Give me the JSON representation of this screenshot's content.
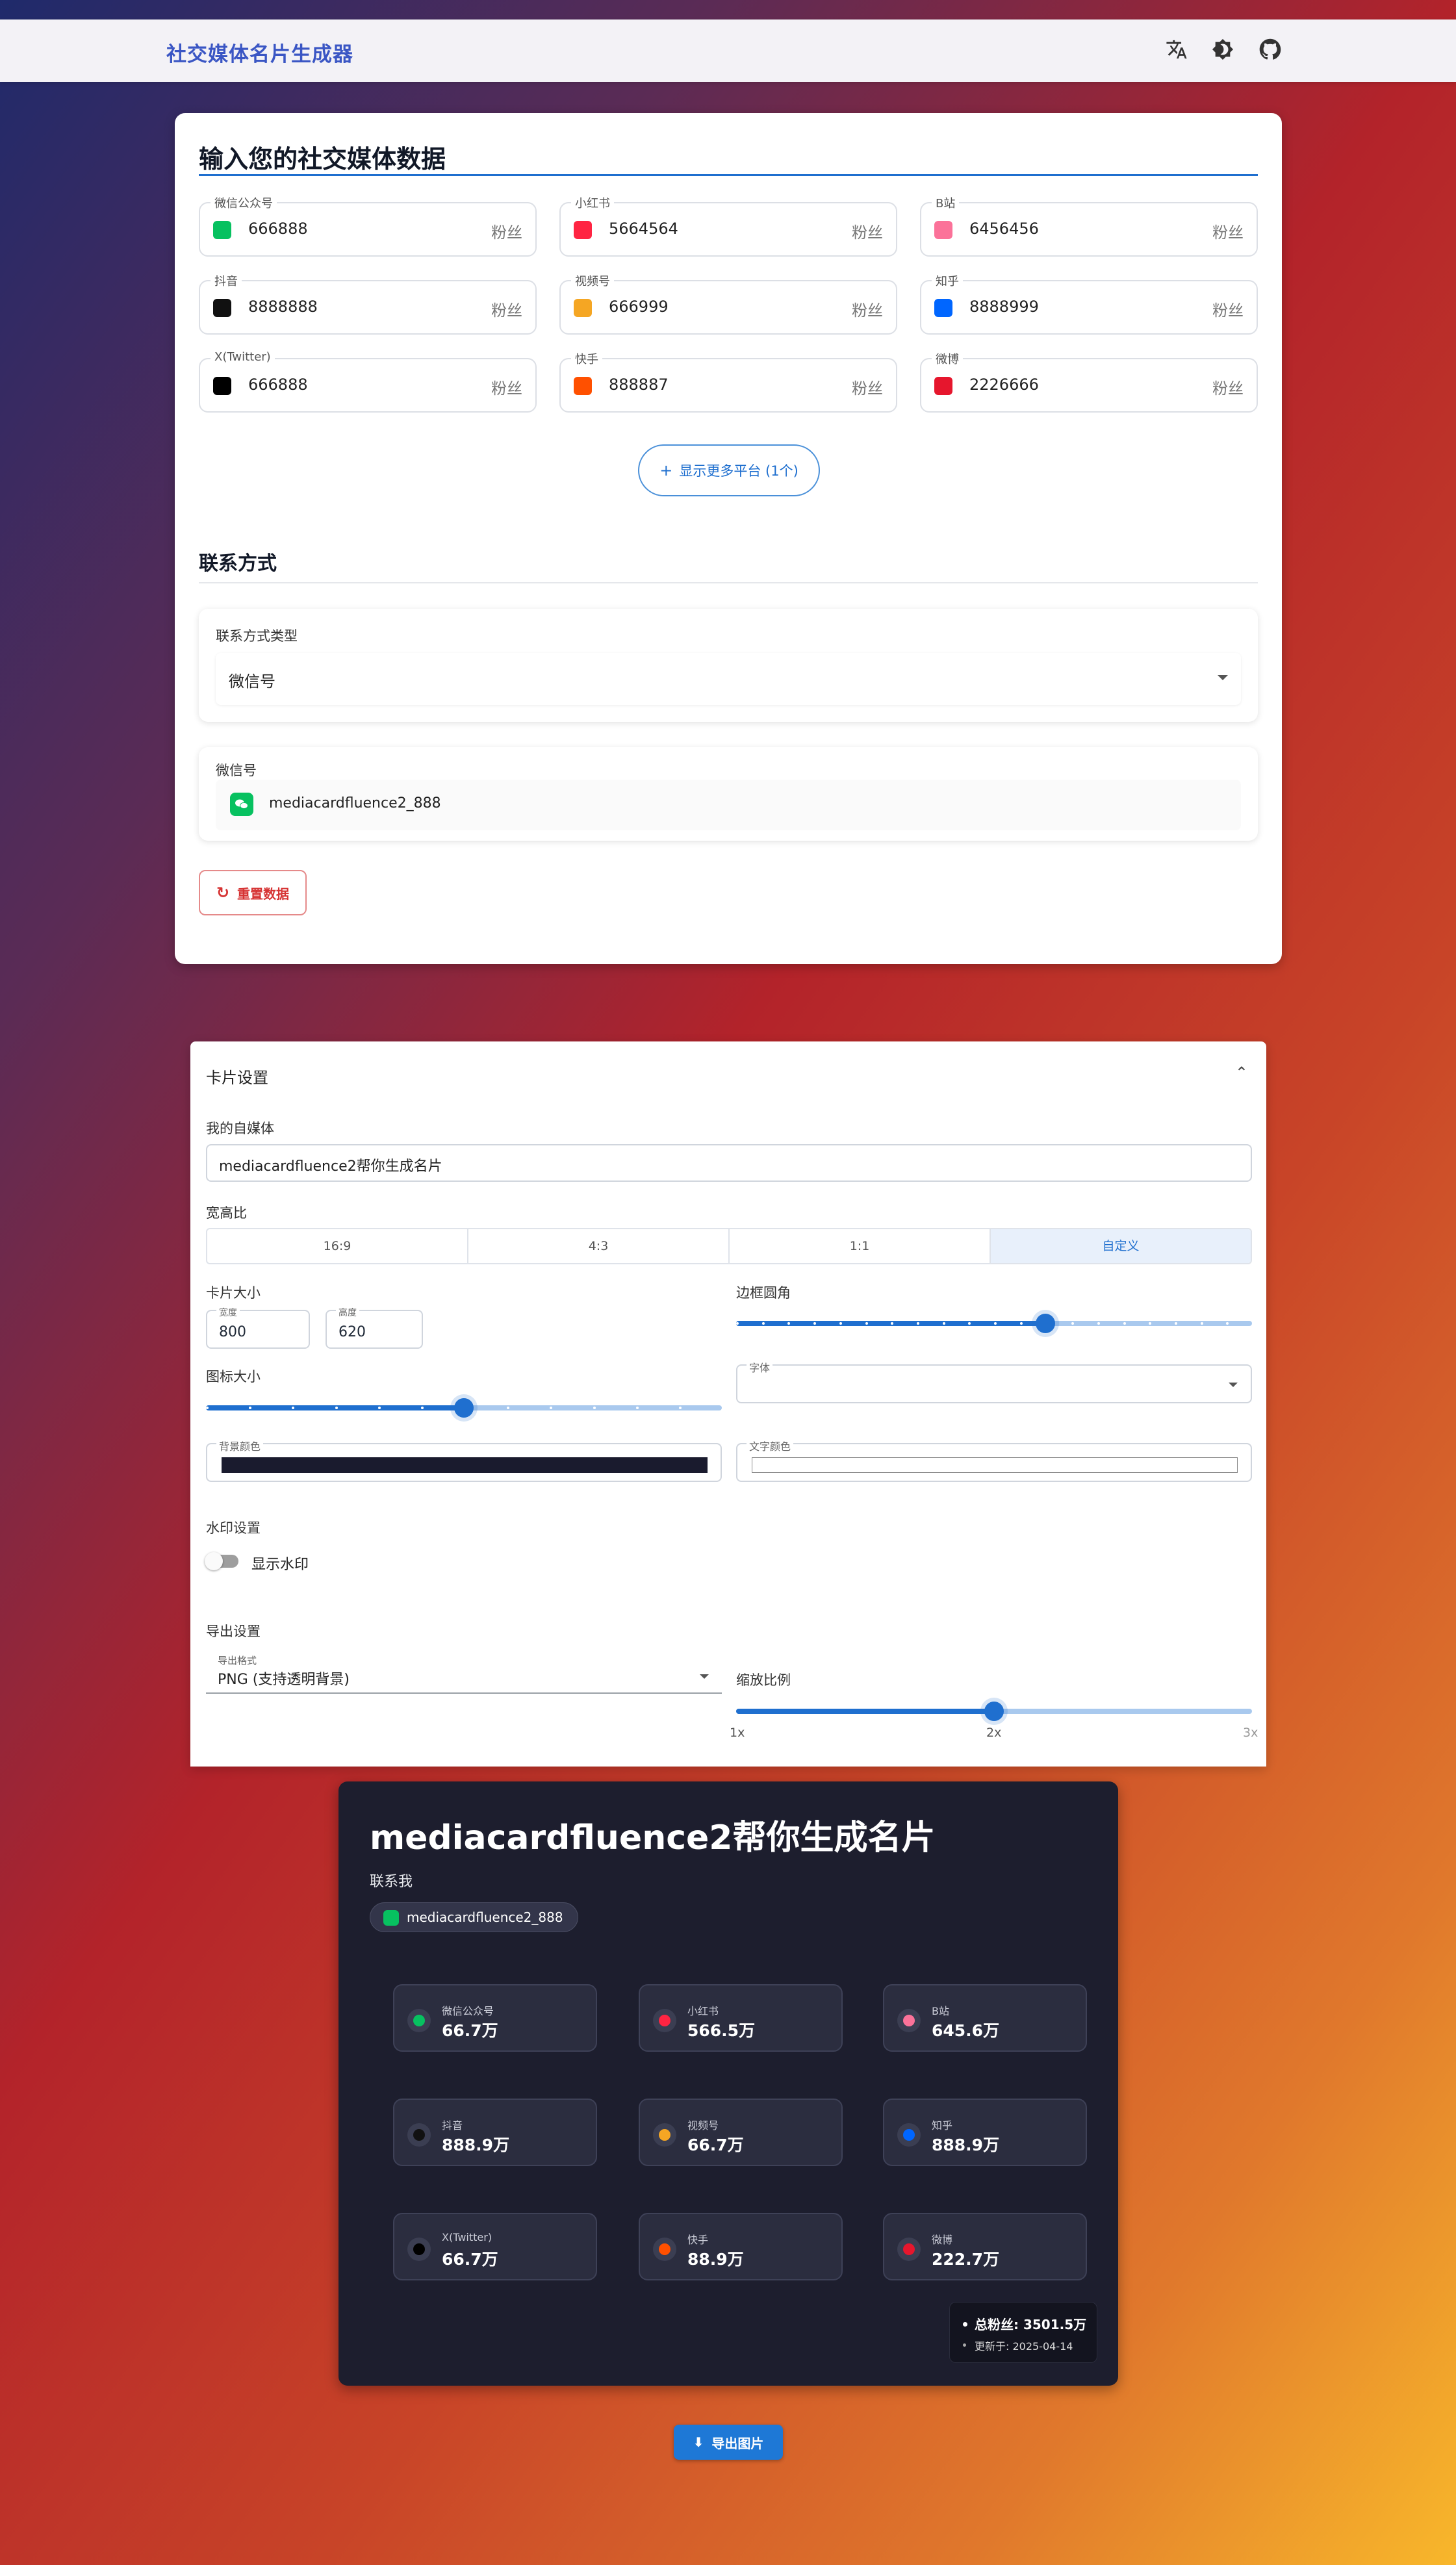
{
  "app": {
    "title": "社交媒体名片生成器"
  },
  "input_section": {
    "title": "输入您的社交媒体数据",
    "unit": "粉丝",
    "platforms": [
      {
        "label": "微信公众号",
        "value": "666888",
        "icon": "wechat-icon",
        "color": "#07c160"
      },
      {
        "label": "小红书",
        "value": "5664564",
        "icon": "xiaohongshu-icon",
        "color": "#ff2442"
      },
      {
        "label": "B站",
        "value": "6456456",
        "icon": "bilibili-icon",
        "color": "#fb7299"
      },
      {
        "label": "抖音",
        "value": "8888888",
        "icon": "douyin-icon",
        "color": "#111111"
      },
      {
        "label": "视频号",
        "value": "666999",
        "icon": "channels-icon",
        "color": "#f5a623"
      },
      {
        "label": "知乎",
        "value": "8888999",
        "icon": "zhihu-icon",
        "color": "#0066ff"
      },
      {
        "label": "X(Twitter)",
        "value": "666888",
        "icon": "x-twitter-icon",
        "color": "#000000"
      },
      {
        "label": "快手",
        "value": "888887",
        "icon": "kuaishou-icon",
        "color": "#ff5000"
      },
      {
        "label": "微博",
        "value": "2226666",
        "icon": "weibo-icon",
        "color": "#e6162d"
      }
    ],
    "show_more_label": "显示更多平台 (1个)",
    "contact_title": "联系方式",
    "contact_type_label": "联系方式类型",
    "contact_type_value": "微信号",
    "contact_field_label": "微信号",
    "contact_field_value": "mediacardfluence2_888",
    "reset_label": "重置数据"
  },
  "settings": {
    "title": "卡片设置",
    "my_media_label": "我的自媒体",
    "my_media_value": "mediacardfluence2帮你生成名片",
    "ratio_label": "宽高比",
    "ratios": [
      "16:9",
      "4:3",
      "1:1",
      "自定义"
    ],
    "ratio_selected": "自定义",
    "card_size_label": "卡片大小",
    "width_label": "宽度",
    "width_value": "800",
    "height_label": "高度",
    "height_value": "620",
    "radius_label": "边框圆角",
    "radius_level": 0.6,
    "icon_size_label": "图标大小",
    "icon_size_level": 0.5,
    "font_label": "字体",
    "font_value": "",
    "bg_color_label": "背景颜色",
    "bg_color": "#1a1b2e",
    "text_color_label": "文字颜色",
    "text_color": "#ffffff",
    "watermark_title": "水印设置",
    "watermark_toggle_label": "显示水印",
    "watermark_on": false,
    "export_title": "导出设置",
    "export_format_label": "导出格式",
    "export_format_value": "PNG (支持透明背景)",
    "scale_label": "缩放比例",
    "scale_ticks": [
      "1x",
      "2x",
      "3x"
    ],
    "scale_value": 2
  },
  "preview": {
    "title": "mediacardfluence2帮你生成名片",
    "contact_heading": "联系我",
    "contact_chip": "mediacardfluence2_888",
    "stats": [
      {
        "name": "微信公众号",
        "value": "66.7万",
        "icon": "wechat-icon",
        "color": "#07c160"
      },
      {
        "name": "小红书",
        "value": "566.5万",
        "icon": "xiaohongshu-icon",
        "color": "#ff2442"
      },
      {
        "name": "B站",
        "value": "645.6万",
        "icon": "bilibili-icon",
        "color": "#fb7299"
      },
      {
        "name": "抖音",
        "value": "888.9万",
        "icon": "douyin-icon",
        "color": "#111111"
      },
      {
        "name": "视频号",
        "value": "66.7万",
        "icon": "channels-icon",
        "color": "#f5a623"
      },
      {
        "name": "知乎",
        "value": "888.9万",
        "icon": "zhihu-icon",
        "color": "#0066ff"
      },
      {
        "name": "X(Twitter)",
        "value": "66.7万",
        "icon": "x-twitter-icon",
        "color": "#000000"
      },
      {
        "name": "快手",
        "value": "88.9万",
        "icon": "kuaishou-icon",
        "color": "#ff5000"
      },
      {
        "name": "微博",
        "value": "222.7万",
        "icon": "weibo-icon",
        "color": "#e6162d"
      }
    ],
    "total_label": "总粉丝: 3501.5万",
    "updated_label": "更新于: 2025-04-14",
    "export_button": "导出图片"
  }
}
